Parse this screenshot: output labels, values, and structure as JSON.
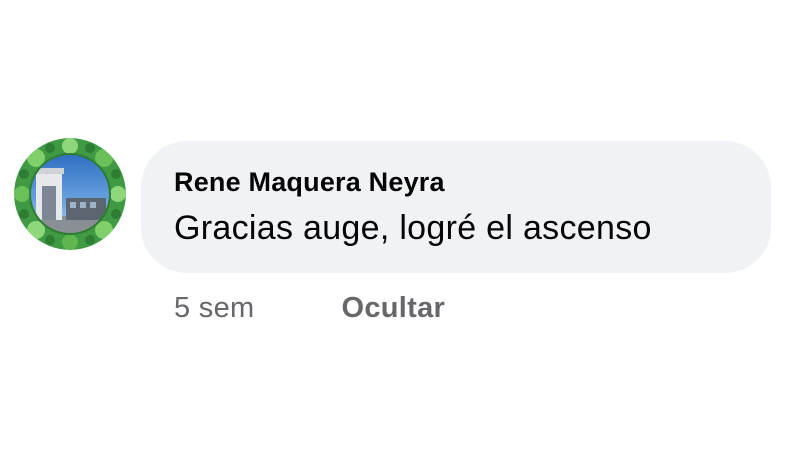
{
  "comment": {
    "author": "Rene Maquera Neyra",
    "text": "Gracias auge, logré el ascenso",
    "timestamp": "5 sem",
    "hide_label": "Ocultar",
    "avatar_icon": "profile-photo-avatar"
  },
  "colors": {
    "bubble_background": "#f0f2f5",
    "primary_text": "#050505",
    "secondary_text": "#65676b",
    "avatar_frame": "#4caf50"
  }
}
